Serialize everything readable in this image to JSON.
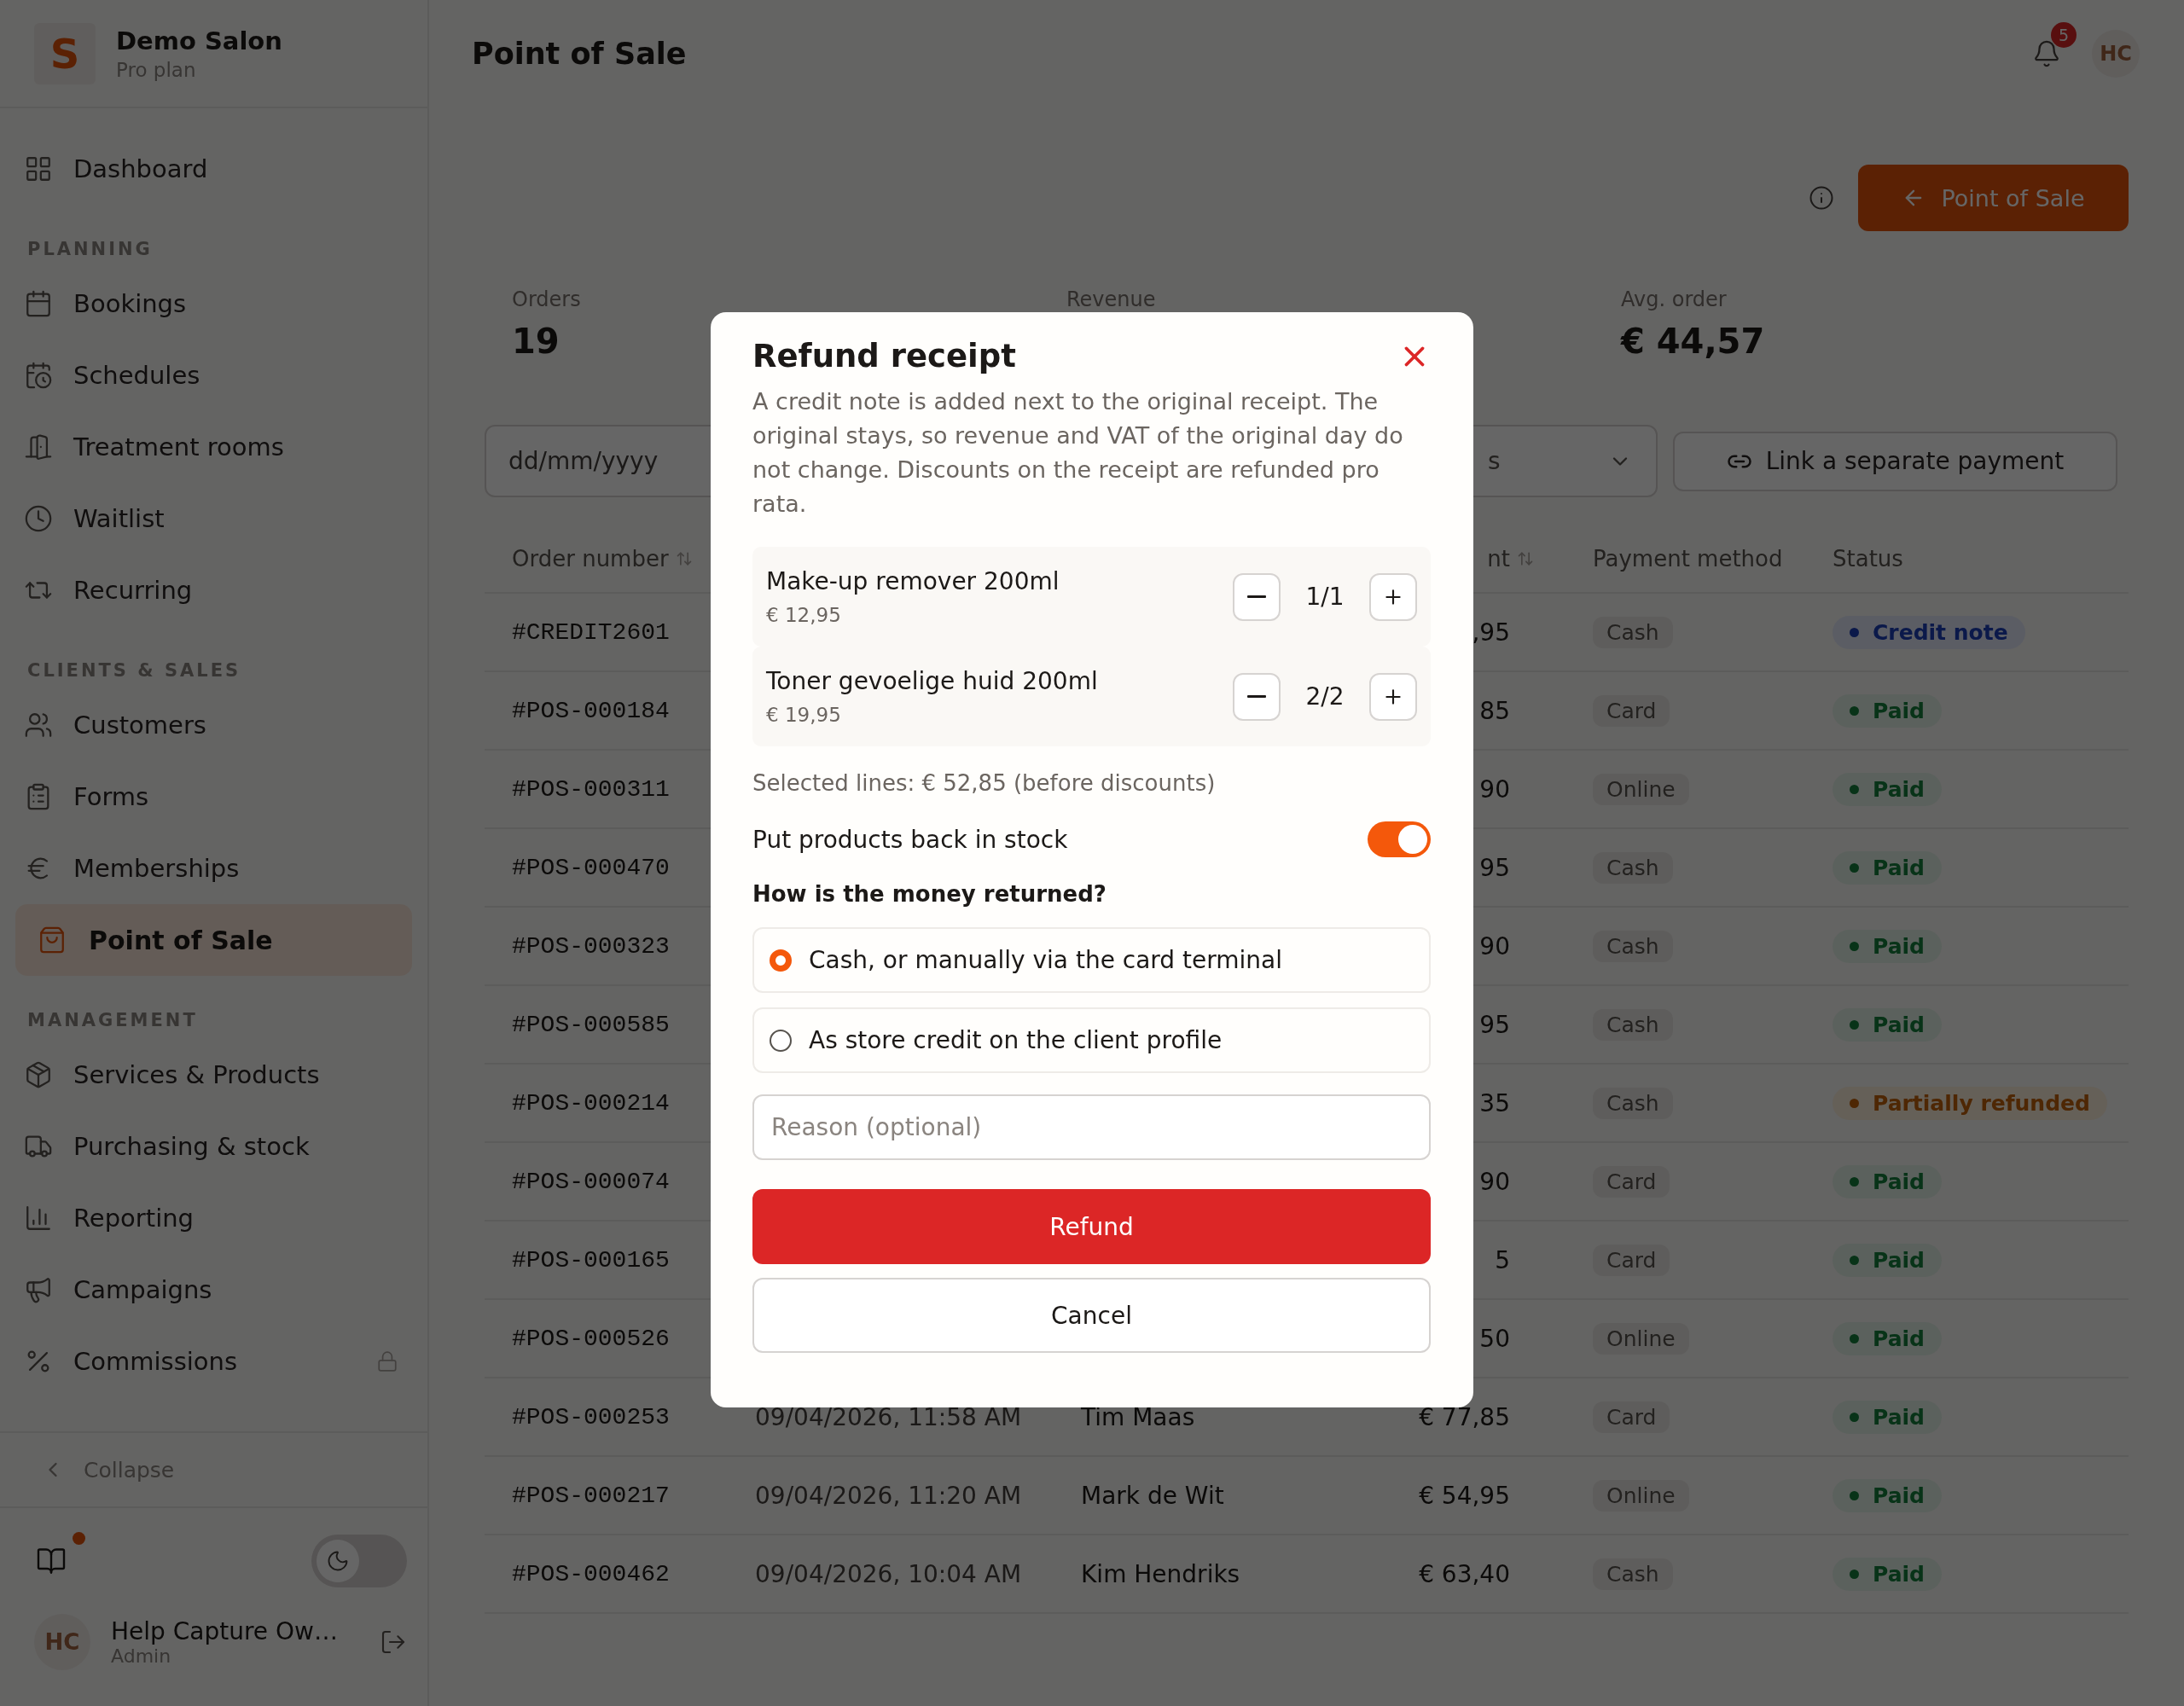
{
  "sidebar": {
    "brand": {
      "logo": "S",
      "name": "Demo Salon",
      "plan": "Pro plan"
    },
    "sections": [
      {
        "items": [
          {
            "label": "Dashboard",
            "selected": false,
            "locked": false
          }
        ]
      },
      {
        "heading": "PLANNING",
        "items": [
          {
            "label": "Bookings",
            "selected": false,
            "locked": false
          },
          {
            "label": "Schedules",
            "selected": false,
            "locked": false
          },
          {
            "label": "Treatment rooms",
            "selected": false,
            "locked": false
          },
          {
            "label": "Waitlist",
            "selected": false,
            "locked": false
          },
          {
            "label": "Recurring",
            "selected": false,
            "locked": false
          }
        ]
      },
      {
        "heading": "CLIENTS & SALES",
        "items": [
          {
            "label": "Customers",
            "selected": false,
            "locked": false
          },
          {
            "label": "Forms",
            "selected": false,
            "locked": false
          },
          {
            "label": "Memberships",
            "selected": false,
            "locked": false
          },
          {
            "label": "Point of Sale",
            "selected": true,
            "locked": false
          }
        ]
      },
      {
        "heading": "MANAGEMENT",
        "items": [
          {
            "label": "Services & Products",
            "selected": false,
            "locked": false
          },
          {
            "label": "Purchasing & stock",
            "selected": false,
            "locked": false
          },
          {
            "label": "Reporting",
            "selected": false,
            "locked": false
          },
          {
            "label": "Campaigns",
            "selected": false,
            "locked": false
          },
          {
            "label": "Commissions",
            "selected": false,
            "locked": true
          }
        ]
      }
    ],
    "collapse": "Collapse",
    "help_unread": true,
    "dark_mode": false,
    "user": {
      "initials": "HC",
      "name": "Help Capture Ow…",
      "role": "Admin"
    }
  },
  "header": {
    "title": "Point of Sale",
    "notifications": "5",
    "avatar": "HC"
  },
  "pos_button": "Point of Sale",
  "stats": [
    {
      "label": "Orders",
      "value": "19"
    },
    {
      "label": "Revenue"
    },
    {
      "label": "Avg. order",
      "value": "€ 44,57"
    }
  ],
  "filters": {
    "date_placeholder": "dd/mm/yyyy",
    "status_select": "s",
    "link_button": "Link a separate payment"
  },
  "table": {
    "columns": [
      {
        "kind": "order",
        "label": "Order number",
        "sortable": true
      },
      {
        "kind": "amount",
        "label": "nt",
        "sortable": true
      },
      {
        "kind": "method",
        "label": "Payment method",
        "sortable": false
      },
      {
        "kind": "status",
        "label": "Status",
        "sortable": false
      }
    ],
    "rows": [
      {
        "order": "#CREDIT2601",
        "amount": ",95",
        "method": "Cash",
        "status": "Credit note",
        "kind": "credit"
      },
      {
        "order": "#POS-000184",
        "amount": "85",
        "method": "Card",
        "status": "Paid",
        "kind": "paid"
      },
      {
        "order": "#POS-000311",
        "amount": "90",
        "method": "Online",
        "status": "Paid",
        "kind": "paid"
      },
      {
        "order": "#POS-000470",
        "amount": "95",
        "method": "Cash",
        "status": "Paid",
        "kind": "paid"
      },
      {
        "order": "#POS-000323",
        "amount": "90",
        "method": "Cash",
        "status": "Paid",
        "kind": "paid"
      },
      {
        "order": "#POS-000585",
        "amount": "95",
        "method": "Cash",
        "status": "Paid",
        "kind": "paid"
      },
      {
        "order": "#POS-000214",
        "amount": "35",
        "method": "Cash",
        "status": "Partially refunded",
        "kind": "partial"
      },
      {
        "order": "#POS-000074",
        "amount": "90",
        "method": "Card",
        "status": "Paid",
        "kind": "paid"
      },
      {
        "order": "#POS-000165",
        "amount": "5",
        "method": "Card",
        "status": "Paid",
        "kind": "paid"
      },
      {
        "order": "#POS-000526",
        "amount": "50",
        "method": "Online",
        "status": "Paid",
        "kind": "paid"
      },
      {
        "order": "#POS-000253",
        "date": "09/04/2026, 11:58 AM",
        "client": "Tim Maas",
        "amount": "€ 77,85",
        "method": "Card",
        "status": "Paid",
        "kind": "paid"
      },
      {
        "order": "#POS-000217",
        "date": "09/04/2026, 11:20 AM",
        "client": "Mark de Wit",
        "amount": "€ 54,95",
        "method": "Online",
        "status": "Paid",
        "kind": "paid"
      },
      {
        "order": "#POS-000462",
        "date": "09/04/2026, 10:04 AM",
        "client": "Kim Hendriks",
        "amount": "€ 63,40",
        "method": "Cash",
        "status": "Paid",
        "kind": "paid"
      }
    ]
  },
  "modal": {
    "title": "Refund receipt",
    "description": "A credit note is added next to the original receipt. The original stays, so revenue and VAT of the original day do not change. Discounts on the receipt are refunded pro rata.",
    "lines": [
      {
        "name": "Make-up remover 200ml",
        "price": "€ 12,95",
        "quantity": "1/1"
      },
      {
        "name": "Toner gevoelige huid 200ml",
        "price": "€ 19,95",
        "quantity": "2/2"
      }
    ],
    "summary": "Selected lines: € 52,85 (before discounts)",
    "restock": {
      "label": "Put products back in stock",
      "on": true
    },
    "question": "How is the money returned?",
    "options": [
      {
        "label": "Cash, or manually via the card terminal",
        "selected": true
      },
      {
        "label": "As store credit on the client profile",
        "selected": false
      }
    ],
    "reason_placeholder": "Reason (optional)",
    "refund_button": "Refund",
    "cancel_button": "Cancel"
  }
}
